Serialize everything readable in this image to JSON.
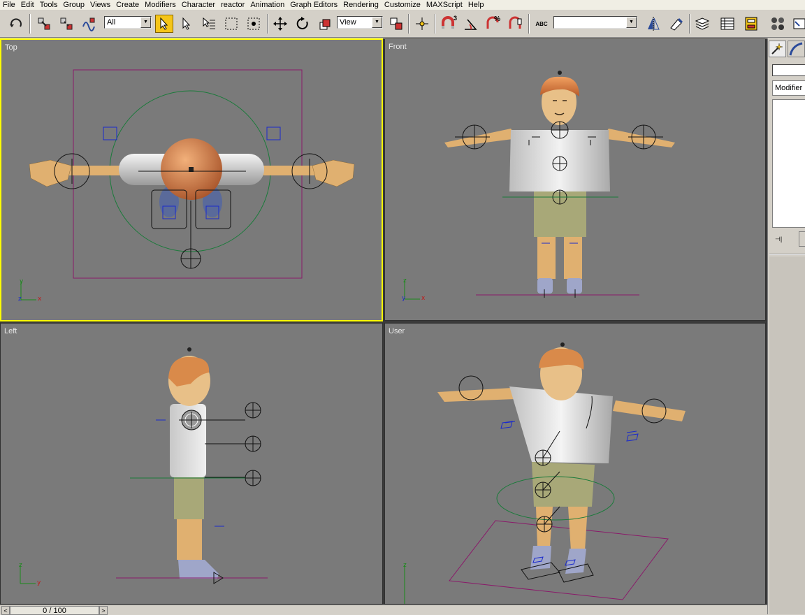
{
  "menubar": {
    "items": [
      "File",
      "Edit",
      "Tools",
      "Group",
      "Views",
      "Create",
      "Modifiers",
      "Character",
      "reactor",
      "Animation",
      "Graph Editors",
      "Rendering",
      "Customize",
      "MAXScript",
      "Help"
    ]
  },
  "toolbar": {
    "selection_filter": "All",
    "reference_coord": "View",
    "named_selection": "",
    "snap_angle_label": "3",
    "percent_snap_label": "%",
    "spinner_snap_label": "ABC"
  },
  "viewports": {
    "top": {
      "label": "Top"
    },
    "front": {
      "label": "Front"
    },
    "left": {
      "label": "Left"
    },
    "user": {
      "label": "User"
    }
  },
  "command_panel": {
    "modifier_list_label": "Modifier L"
  },
  "timeline": {
    "frame_readout": "0 / 100",
    "prev_label": "<",
    "next_label": ">"
  },
  "colors": {
    "viewport_bg": "#7a7a7a",
    "active_border": "#ffff00",
    "skin": "#e0b070",
    "hair": "#d98a4a",
    "shirt": "#e6e6e6",
    "shorts": "#a8a878",
    "shoes": "#9fa6c9",
    "ground_line": "#8a1a6a",
    "ring": "#1a7a3a"
  }
}
